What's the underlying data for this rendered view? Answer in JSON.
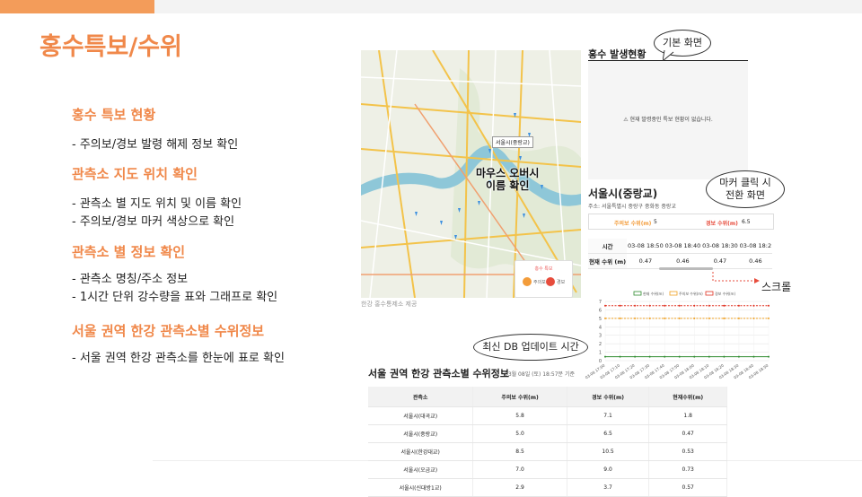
{
  "slide": {
    "title": "홍수특보/수위",
    "sections": [
      {
        "heading": "홍수 특보 현황",
        "items": [
          "- 주의보/경보 발령 해제 정보 확인"
        ]
      },
      {
        "heading": "관측소 지도 위치 확인",
        "items": [
          "- 관측소 별 지도 위치 및 이름 확인",
          "- 주의보/경보 마커 색상으로  확인"
        ]
      },
      {
        "heading": "관측소 별 정보 확인",
        "items": [
          "- 관측소 명칭/주소 정보",
          "- 1시간 단위 강수량을 표와 그래프로 확인"
        ]
      },
      {
        "heading": "서울 권역 한강 관측소별 수위정보",
        "items": [
          "- 서울 권역 한강 관측소를 한눈에 표로 확인"
        ]
      }
    ]
  },
  "map": {
    "popup_label": "서울시(중랑교)",
    "overlay_label_1": "마우스 오버시",
    "overlay_label_2": "이름 확인",
    "legend_title": "홍수 특보",
    "legend_items": [
      "주의보",
      "경보"
    ],
    "caption": "한강 홍수통제소 제공"
  },
  "flood_status": {
    "title": "홍수 발생현황",
    "message": "⚠ 현재 발령중인 특보 현황이 없습니다."
  },
  "callouts": {
    "default_view": "기본 화면",
    "marker_click_1": "마커 클릭 시",
    "marker_click_2": "전환 화면",
    "scroll": "스크롤",
    "latest_db": "최신 DB 업데이트 시간"
  },
  "station": {
    "name": "서울시(중랑교)",
    "address": "주소: 서울특별시 중랑구 중화동 중랑교",
    "caution_label": "주의보 수위(m)",
    "caution_value": "5",
    "warning_label": "경보 수위(m)",
    "warning_value": "6.5",
    "table": {
      "time_label": "시간",
      "level_label": "현재 수위 (m)",
      "times": [
        "03-08 18:50",
        "03-08 18:40",
        "03-08 18:30",
        "03-08 18:2"
      ],
      "levels": [
        "0.47",
        "0.46",
        "0.47",
        "0.46"
      ]
    }
  },
  "chart_data": {
    "type": "line",
    "x": [
      "03-08 17:00",
      "03-08 17:10",
      "03-08 17:20",
      "03-08 17:30",
      "03-08 17:40",
      "03-08 17:50",
      "03-08 18:00",
      "03-08 18:10",
      "03-08 18:20",
      "03-08 18:30",
      "03-08 18:40",
      "03-08 18:50"
    ],
    "series": [
      {
        "name": "현재 수위(m)",
        "values": [
          0.47,
          0.47,
          0.46,
          0.46,
          0.47,
          0.46,
          0.47,
          0.46,
          0.47,
          0.47,
          0.46,
          0.47
        ],
        "color": "#2e8b2e"
      },
      {
        "name": "주의보 수위(m)",
        "values": [
          5,
          5,
          5,
          5,
          5,
          5,
          5,
          5,
          5,
          5,
          5,
          5
        ],
        "color": "#f0a020"
      },
      {
        "name": "경보 수위(m)",
        "values": [
          6.5,
          6.5,
          6.5,
          6.5,
          6.5,
          6.5,
          6.5,
          6.5,
          6.5,
          6.5,
          6.5,
          6.5
        ],
        "color": "#e03020"
      }
    ],
    "ylim": [
      0,
      7
    ],
    "yticks": [
      "0",
      "1",
      "2",
      "3",
      "4",
      "5",
      "6",
      "7"
    ],
    "xticks": [
      "03-08 17:00",
      "03-08 17:10",
      "03-08 17:20",
      "03-08 17:30",
      "03-08 17:40",
      "03-08 17:50",
      "03-08 18:00",
      "03-08 18:10",
      "03-08 18:20",
      "03-08 18:30",
      "03-08 18:40",
      "03-08 18:50"
    ],
    "legend": "top",
    "grid": true
  },
  "seoul": {
    "title": "서울 권역 한강 관측소별 수위정보",
    "timestamp": "03월 08일 (토) 18:57분 기준",
    "columns": [
      "관측소",
      "주의보 수위(m)",
      "경보 수위(m)",
      "현재수위(m)"
    ],
    "rows": [
      [
        "서울시(대곡교)",
        "5.8",
        "7.1",
        "1.8"
      ],
      [
        "서울시(중랑교)",
        "5.0",
        "6.5",
        "0.47"
      ],
      [
        "서울시(한강대교)",
        "8.5",
        "10.5",
        "0.53"
      ],
      [
        "서울시(오금교)",
        "7.0",
        "9.0",
        "0.73"
      ],
      [
        "서울시(신대방1교)",
        "2.9",
        "3.7",
        "0.57"
      ]
    ]
  },
  "colors": {
    "accent": "#f0884a",
    "caution": "#f39c3a",
    "warning": "#e74c3c"
  }
}
